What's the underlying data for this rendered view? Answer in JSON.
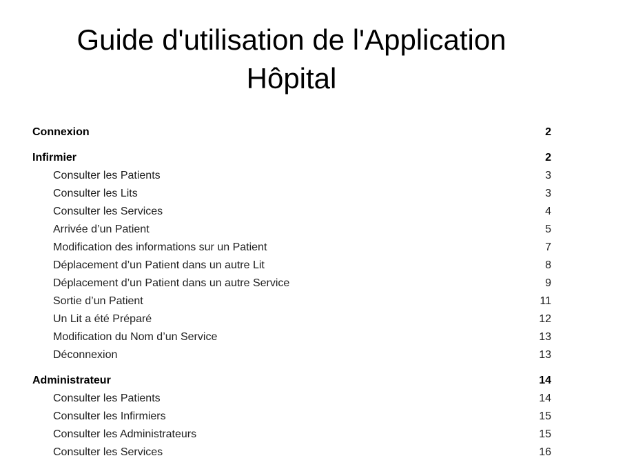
{
  "document": {
    "title": "Guide d'utilisation de l'Application Hôpital"
  },
  "toc": [
    {
      "label": "Connexion",
      "page": "2",
      "level": 1
    },
    {
      "label": "Infirmier",
      "page": "2",
      "level": 1
    },
    {
      "label": "Consulter les Patients",
      "page": "3",
      "level": 2
    },
    {
      "label": "Consulter les Lits",
      "page": "3",
      "level": 2
    },
    {
      "label": "Consulter les Services",
      "page": "4",
      "level": 2
    },
    {
      "label": "Arrivée d’un Patient",
      "page": "5",
      "level": 2
    },
    {
      "label": "Modification des informations sur un Patient",
      "page": "7",
      "level": 2
    },
    {
      "label": "Déplacement d’un Patient dans un autre Lit",
      "page": "8",
      "level": 2
    },
    {
      "label": "Déplacement d’un Patient dans un autre Service",
      "page": "9",
      "level": 2
    },
    {
      "label": "Sortie d’un Patient",
      "page": "11",
      "level": 2
    },
    {
      "label": "Un Lit a été Préparé",
      "page": "12",
      "level": 2
    },
    {
      "label": "Modification du Nom d’un Service",
      "page": "13",
      "level": 2
    },
    {
      "label": "Déconnexion",
      "page": "13",
      "level": 2
    },
    {
      "label": "Administrateur",
      "page": "14",
      "level": 1
    },
    {
      "label": "Consulter les Patients",
      "page": "14",
      "level": 2
    },
    {
      "label": "Consulter les Infirmiers",
      "page": "15",
      "level": 2
    },
    {
      "label": "Consulter les Administrateurs",
      "page": "15",
      "level": 2
    },
    {
      "label": "Consulter les Services",
      "page": "16",
      "level": 2
    }
  ]
}
